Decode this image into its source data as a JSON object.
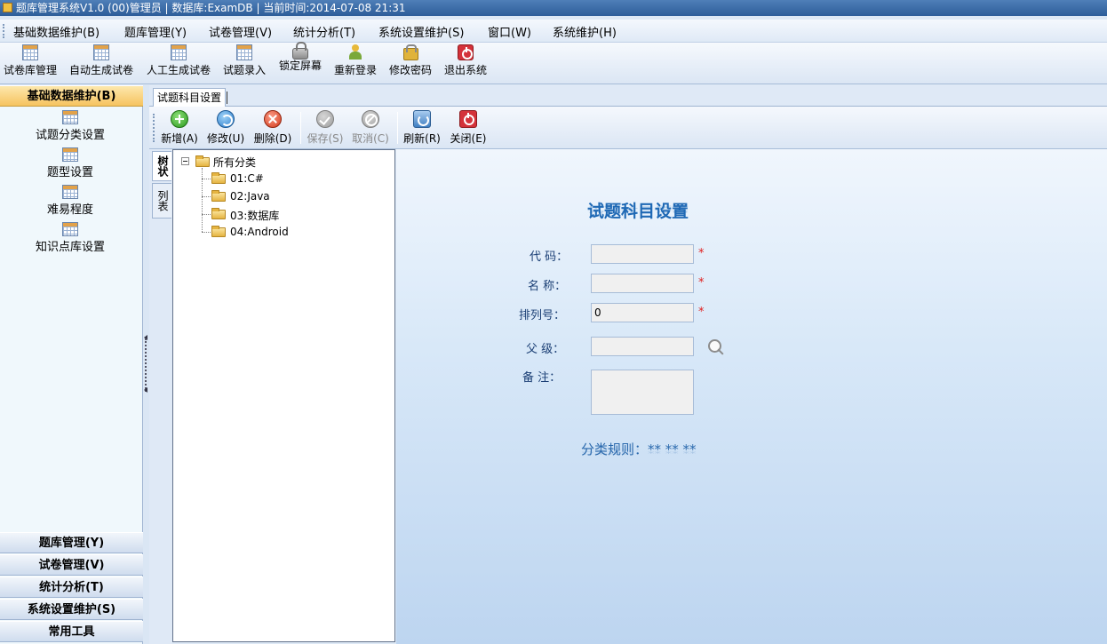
{
  "window": {
    "title": "题库管理系统V1.0   (00)管理员  | 数据库:ExamDB  |  当前时间:2014-07-08 21:31"
  },
  "menu": [
    "基础数据维护(B)",
    "题库管理(Y)",
    "试卷管理(V)",
    "统计分析(T)",
    "系统设置维护(S)",
    "窗口(W)",
    "系统维护(H)"
  ],
  "toolbar": [
    {
      "label": "试卷库管理",
      "icon": "grid-icon"
    },
    {
      "label": "自动生成试卷",
      "icon": "grid-icon"
    },
    {
      "label": "人工生成试卷",
      "icon": "grid-icon"
    },
    {
      "label": "试题录入",
      "icon": "grid-icon"
    },
    {
      "label": "锁定屏幕",
      "icon": "lock-icon"
    },
    {
      "label": "重新登录",
      "icon": "user-icon"
    },
    {
      "label": "修改密码",
      "icon": "key-icon"
    },
    {
      "label": "退出系统",
      "icon": "power-icon"
    }
  ],
  "leftnav": {
    "active_header": "基础数据维护(B)",
    "items": [
      "试题分类设置",
      "题型设置",
      "难易程度",
      "知识点库设置"
    ],
    "headers": [
      "题库管理(Y)",
      "试卷管理(V)",
      "统计分析(T)",
      "系统设置维护(S)",
      "常用工具"
    ]
  },
  "doc_tab": "试题科目设置",
  "actions": [
    {
      "label": "新增(A)",
      "icon": "add-icon",
      "enabled": true
    },
    {
      "label": "修改(U)",
      "icon": "edit-icon",
      "enabled": true
    },
    {
      "label": "删除(D)",
      "icon": "delete-icon",
      "enabled": true
    },
    {
      "label": "保存(S)",
      "icon": "save-icon",
      "enabled": false
    },
    {
      "label": "取消(C)",
      "icon": "cancel-icon",
      "enabled": false
    },
    {
      "label": "刷新(R)",
      "icon": "refresh-icon",
      "enabled": true
    },
    {
      "label": "关闭(E)",
      "icon": "close-icon",
      "enabled": true
    }
  ],
  "view_tabs": [
    "树状",
    "列表"
  ],
  "tree": {
    "root": "所有分类",
    "children": [
      "01:C#",
      "02:Java",
      "03:数据库",
      "04:Android"
    ]
  },
  "form": {
    "title": "试题科目设置",
    "code_label": "代 码：",
    "name_label": "名 称：",
    "order_label": "排列号：",
    "order_value": "0",
    "parent_label": "父 级：",
    "note_label": "备 注：",
    "required_mark": "*",
    "rule": "分类规则：** ** **"
  },
  "colors": {
    "accent_title": "#1f69b5",
    "active_nav": "#f6c35f",
    "required": "#e02020"
  }
}
